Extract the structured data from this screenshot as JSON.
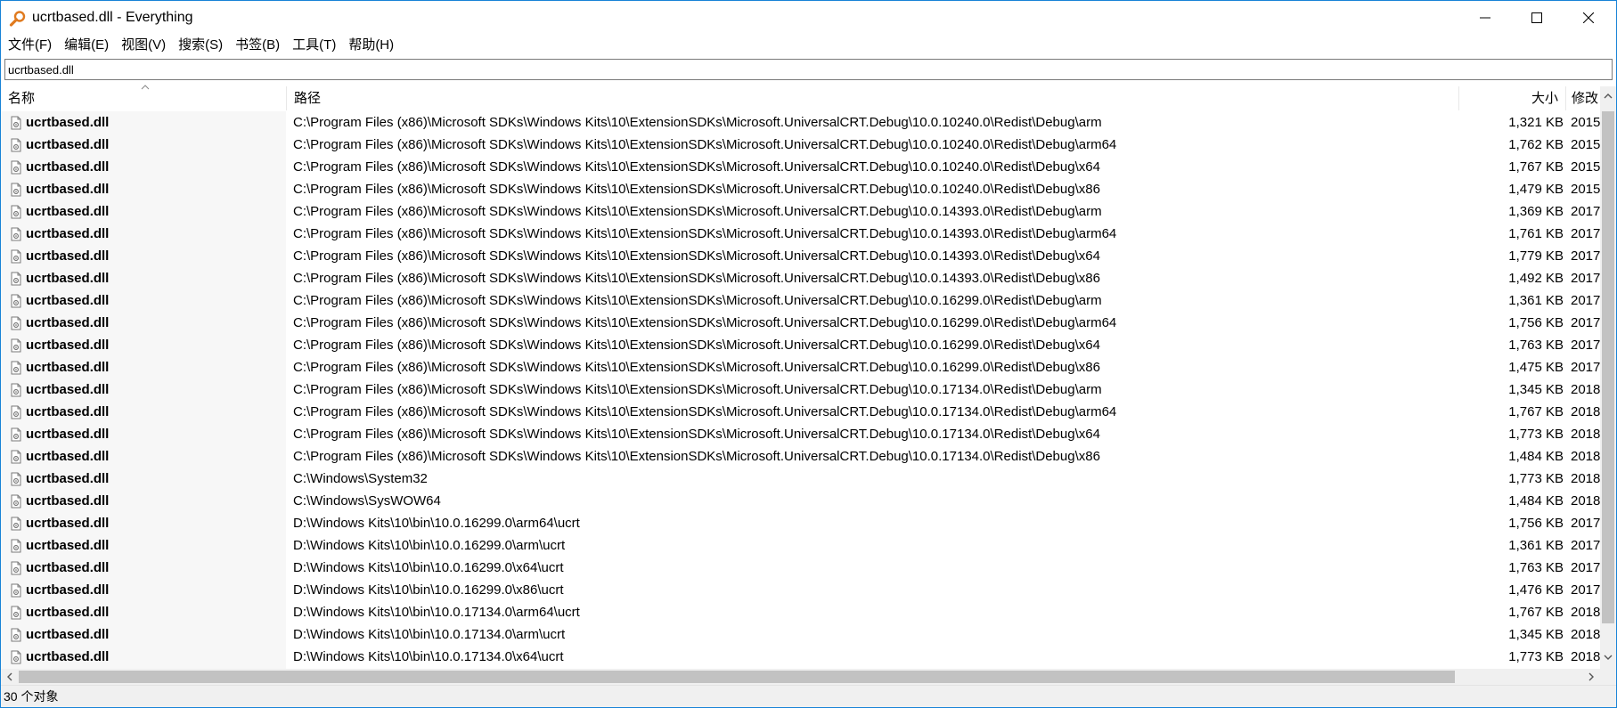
{
  "window": {
    "title": "ucrtbased.dll - Everything"
  },
  "menu": {
    "items": [
      "文件(F)",
      "编辑(E)",
      "视图(V)",
      "搜索(S)",
      "书签(B)",
      "工具(T)",
      "帮助(H)"
    ]
  },
  "search": {
    "value": "ucrtbased.dll"
  },
  "columns": {
    "name": "名称",
    "path": "路径",
    "size": "大小",
    "modified": "修改"
  },
  "rows": [
    {
      "name": "ucrtbased.dll",
      "path": "C:\\Program Files (x86)\\Microsoft SDKs\\Windows Kits\\10\\ExtensionSDKs\\Microsoft.UniversalCRT.Debug\\10.0.10240.0\\Redist\\Debug\\arm",
      "size": "1,321 KB",
      "modified": "2015"
    },
    {
      "name": "ucrtbased.dll",
      "path": "C:\\Program Files (x86)\\Microsoft SDKs\\Windows Kits\\10\\ExtensionSDKs\\Microsoft.UniversalCRT.Debug\\10.0.10240.0\\Redist\\Debug\\arm64",
      "size": "1,762 KB",
      "modified": "2015"
    },
    {
      "name": "ucrtbased.dll",
      "path": "C:\\Program Files (x86)\\Microsoft SDKs\\Windows Kits\\10\\ExtensionSDKs\\Microsoft.UniversalCRT.Debug\\10.0.10240.0\\Redist\\Debug\\x64",
      "size": "1,767 KB",
      "modified": "2015"
    },
    {
      "name": "ucrtbased.dll",
      "path": "C:\\Program Files (x86)\\Microsoft SDKs\\Windows Kits\\10\\ExtensionSDKs\\Microsoft.UniversalCRT.Debug\\10.0.10240.0\\Redist\\Debug\\x86",
      "size": "1,479 KB",
      "modified": "2015"
    },
    {
      "name": "ucrtbased.dll",
      "path": "C:\\Program Files (x86)\\Microsoft SDKs\\Windows Kits\\10\\ExtensionSDKs\\Microsoft.UniversalCRT.Debug\\10.0.14393.0\\Redist\\Debug\\arm",
      "size": "1,369 KB",
      "modified": "2017"
    },
    {
      "name": "ucrtbased.dll",
      "path": "C:\\Program Files (x86)\\Microsoft SDKs\\Windows Kits\\10\\ExtensionSDKs\\Microsoft.UniversalCRT.Debug\\10.0.14393.0\\Redist\\Debug\\arm64",
      "size": "1,761 KB",
      "modified": "2017"
    },
    {
      "name": "ucrtbased.dll",
      "path": "C:\\Program Files (x86)\\Microsoft SDKs\\Windows Kits\\10\\ExtensionSDKs\\Microsoft.UniversalCRT.Debug\\10.0.14393.0\\Redist\\Debug\\x64",
      "size": "1,779 KB",
      "modified": "2017"
    },
    {
      "name": "ucrtbased.dll",
      "path": "C:\\Program Files (x86)\\Microsoft SDKs\\Windows Kits\\10\\ExtensionSDKs\\Microsoft.UniversalCRT.Debug\\10.0.14393.0\\Redist\\Debug\\x86",
      "size": "1,492 KB",
      "modified": "2017"
    },
    {
      "name": "ucrtbased.dll",
      "path": "C:\\Program Files (x86)\\Microsoft SDKs\\Windows Kits\\10\\ExtensionSDKs\\Microsoft.UniversalCRT.Debug\\10.0.16299.0\\Redist\\Debug\\arm",
      "size": "1,361 KB",
      "modified": "2017"
    },
    {
      "name": "ucrtbased.dll",
      "path": "C:\\Program Files (x86)\\Microsoft SDKs\\Windows Kits\\10\\ExtensionSDKs\\Microsoft.UniversalCRT.Debug\\10.0.16299.0\\Redist\\Debug\\arm64",
      "size": "1,756 KB",
      "modified": "2017"
    },
    {
      "name": "ucrtbased.dll",
      "path": "C:\\Program Files (x86)\\Microsoft SDKs\\Windows Kits\\10\\ExtensionSDKs\\Microsoft.UniversalCRT.Debug\\10.0.16299.0\\Redist\\Debug\\x64",
      "size": "1,763 KB",
      "modified": "2017"
    },
    {
      "name": "ucrtbased.dll",
      "path": "C:\\Program Files (x86)\\Microsoft SDKs\\Windows Kits\\10\\ExtensionSDKs\\Microsoft.UniversalCRT.Debug\\10.0.16299.0\\Redist\\Debug\\x86",
      "size": "1,475 KB",
      "modified": "2017"
    },
    {
      "name": "ucrtbased.dll",
      "path": "C:\\Program Files (x86)\\Microsoft SDKs\\Windows Kits\\10\\ExtensionSDKs\\Microsoft.UniversalCRT.Debug\\10.0.17134.0\\Redist\\Debug\\arm",
      "size": "1,345 KB",
      "modified": "2018"
    },
    {
      "name": "ucrtbased.dll",
      "path": "C:\\Program Files (x86)\\Microsoft SDKs\\Windows Kits\\10\\ExtensionSDKs\\Microsoft.UniversalCRT.Debug\\10.0.17134.0\\Redist\\Debug\\arm64",
      "size": "1,767 KB",
      "modified": "2018"
    },
    {
      "name": "ucrtbased.dll",
      "path": "C:\\Program Files (x86)\\Microsoft SDKs\\Windows Kits\\10\\ExtensionSDKs\\Microsoft.UniversalCRT.Debug\\10.0.17134.0\\Redist\\Debug\\x64",
      "size": "1,773 KB",
      "modified": "2018"
    },
    {
      "name": "ucrtbased.dll",
      "path": "C:\\Program Files (x86)\\Microsoft SDKs\\Windows Kits\\10\\ExtensionSDKs\\Microsoft.UniversalCRT.Debug\\10.0.17134.0\\Redist\\Debug\\x86",
      "size": "1,484 KB",
      "modified": "2018"
    },
    {
      "name": "ucrtbased.dll",
      "path": "C:\\Windows\\System32",
      "size": "1,773 KB",
      "modified": "2018"
    },
    {
      "name": "ucrtbased.dll",
      "path": "C:\\Windows\\SysWOW64",
      "size": "1,484 KB",
      "modified": "2018"
    },
    {
      "name": "ucrtbased.dll",
      "path": "D:\\Windows Kits\\10\\bin\\10.0.16299.0\\arm64\\ucrt",
      "size": "1,756 KB",
      "modified": "2017"
    },
    {
      "name": "ucrtbased.dll",
      "path": "D:\\Windows Kits\\10\\bin\\10.0.16299.0\\arm\\ucrt",
      "size": "1,361 KB",
      "modified": "2017"
    },
    {
      "name": "ucrtbased.dll",
      "path": "D:\\Windows Kits\\10\\bin\\10.0.16299.0\\x64\\ucrt",
      "size": "1,763 KB",
      "modified": "2017"
    },
    {
      "name": "ucrtbased.dll",
      "path": "D:\\Windows Kits\\10\\bin\\10.0.16299.0\\x86\\ucrt",
      "size": "1,476 KB",
      "modified": "2017"
    },
    {
      "name": "ucrtbased.dll",
      "path": "D:\\Windows Kits\\10\\bin\\10.0.17134.0\\arm64\\ucrt",
      "size": "1,767 KB",
      "modified": "2018"
    },
    {
      "name": "ucrtbased.dll",
      "path": "D:\\Windows Kits\\10\\bin\\10.0.17134.0\\arm\\ucrt",
      "size": "1,345 KB",
      "modified": "2018"
    },
    {
      "name": "ucrtbased.dll",
      "path": "D:\\Windows Kits\\10\\bin\\10.0.17134.0\\x64\\ucrt",
      "size": "1,773 KB",
      "modified": "2018"
    }
  ],
  "status": {
    "text": "30 个对象"
  },
  "icons": {
    "app": "magnifier-icon",
    "file": "dll-file-icon"
  },
  "colors": {
    "accent": "#1883d7",
    "app_icon": "#e07a1f",
    "scrollbar_thumb": "#c2c2c2",
    "name_column_bg": "#f7f7f7"
  }
}
